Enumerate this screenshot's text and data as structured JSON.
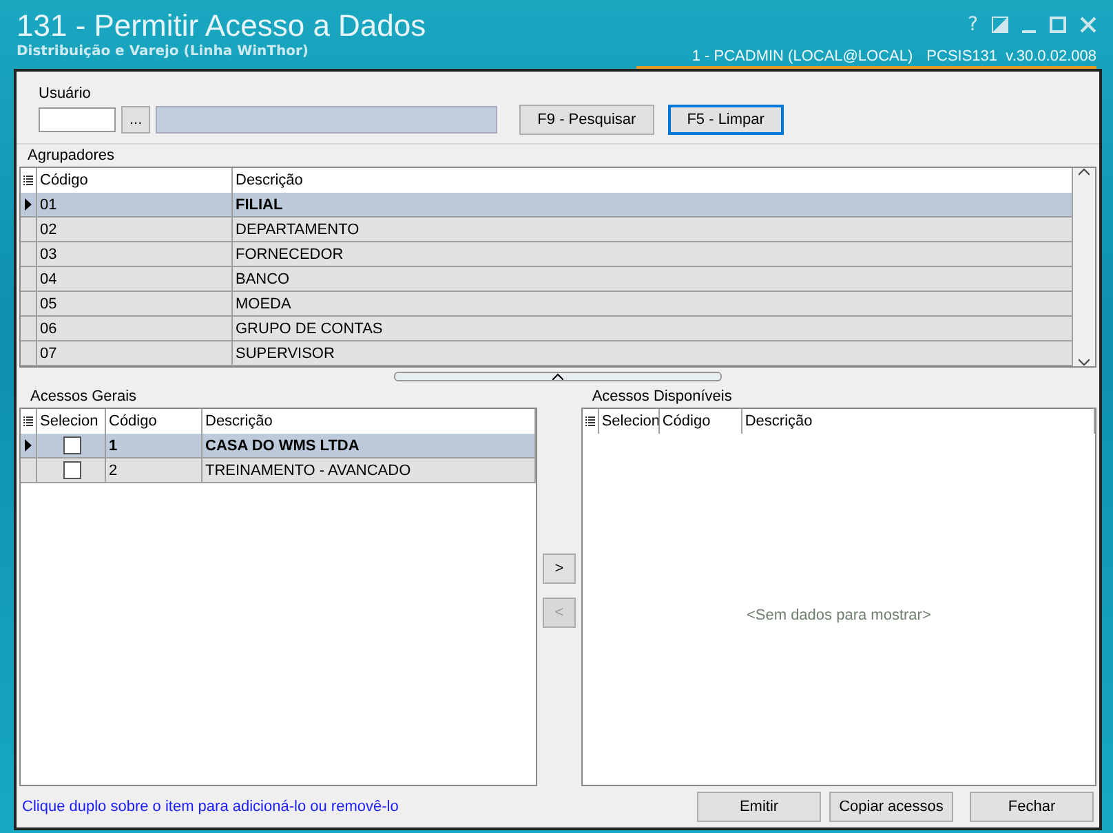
{
  "window": {
    "title": "131 - Permitir Acesso a Dados",
    "subtitle": "Distribuição e Varejo (Linha WinThor)",
    "session": "1 - PCADMIN (LOCAL@LOCAL)",
    "version": "PCSIS131  v.30.0.02.008",
    "help": "?"
  },
  "user": {
    "label": "Usuário",
    "lookup": "...",
    "buttons": [
      {
        "label": "F9 - Pesquisar",
        "focused": false
      },
      {
        "label": "F5 - Limpar",
        "focused": true
      }
    ]
  },
  "agrupadores": {
    "title": "Agrupadores",
    "columns": [
      "Código",
      "Descrição"
    ],
    "rows": [
      {
        "code": "01",
        "description": "FILIAL",
        "selected": true
      },
      {
        "code": "02",
        "description": "DEPARTAMENTO",
        "selected": false
      },
      {
        "code": "03",
        "description": "FORNECEDOR",
        "selected": false
      },
      {
        "code": "04",
        "description": "BANCO",
        "selected": false
      },
      {
        "code": "05",
        "description": "MOEDA",
        "selected": false
      },
      {
        "code": "06",
        "description": "GRUPO DE CONTAS",
        "selected": false
      },
      {
        "code": "07",
        "description": "SUPERVISOR",
        "selected": false
      }
    ]
  },
  "acessos_gerais": {
    "title": "Acessos Gerais",
    "columns": [
      "Selecion",
      "Código",
      "Descrição"
    ],
    "rows": [
      {
        "checked": false,
        "code": "1",
        "description": "CASA DO WMS LTDA",
        "selected": true
      },
      {
        "checked": false,
        "code": "2",
        "description": "TREINAMENTO - AVANCADO",
        "selected": false
      }
    ]
  },
  "transfer": [
    {
      "label": ">",
      "disabled": false
    },
    {
      "label": "<",
      "disabled": true
    }
  ],
  "acessos_disponiveis": {
    "title": "Acessos Disponíveis",
    "columns": [
      "Selecion",
      "Código",
      "Descrição"
    ],
    "empty_text": "<Sem dados para mostrar>"
  },
  "hint": "Clique duplo sobre o item para adicioná-lo ou removê-lo",
  "footer_buttons": [
    "Emitir",
    "Copiar acessos",
    "Fechar"
  ]
}
